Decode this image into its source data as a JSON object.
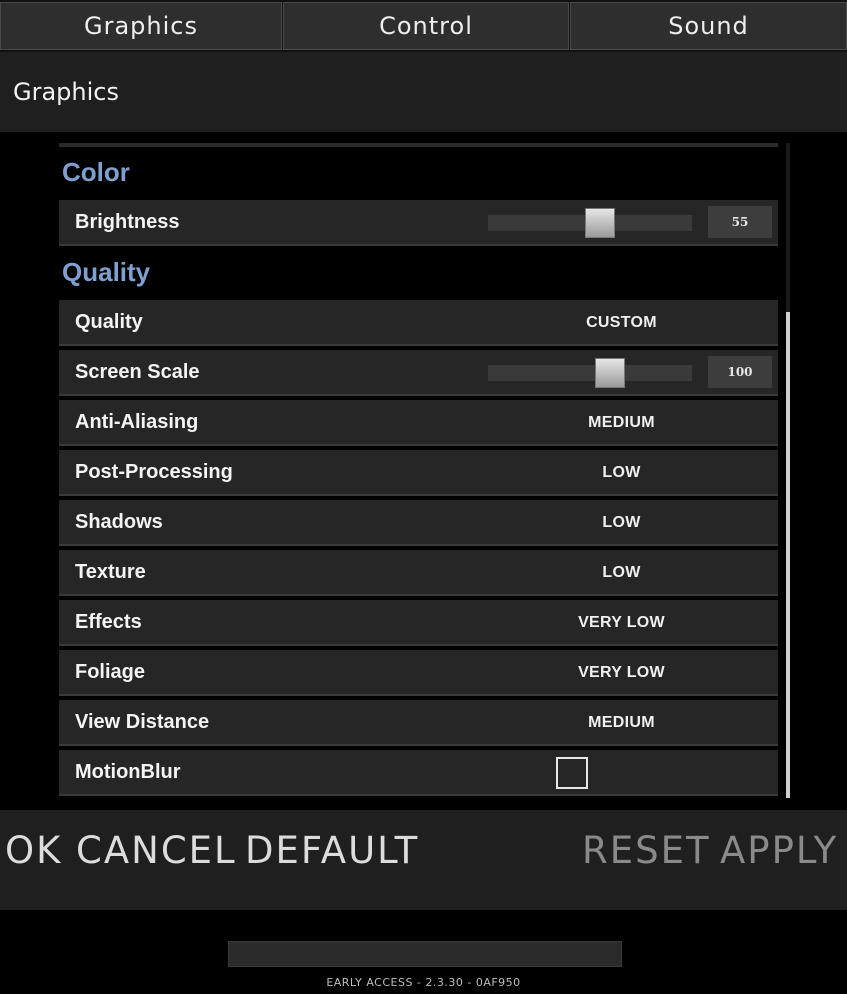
{
  "tabs": [
    "Graphics",
    "Control",
    "Sound"
  ],
  "section_title": "Graphics",
  "groups": {
    "color": "Color",
    "quality": "Quality"
  },
  "brightness": {
    "label": "Brightness",
    "value": "55",
    "level": 0.55
  },
  "quality": {
    "label": "Quality",
    "value": "CUSTOM"
  },
  "screen_scale": {
    "label": "Screen Scale",
    "value": "100",
    "level": 0.6
  },
  "options": [
    {
      "label": "Anti-Aliasing",
      "value": "MEDIUM"
    },
    {
      "label": "Post-Processing",
      "value": "LOW"
    },
    {
      "label": "Shadows",
      "value": "LOW"
    },
    {
      "label": "Texture",
      "value": "LOW"
    },
    {
      "label": "Effects",
      "value": "VERY LOW"
    },
    {
      "label": "Foliage",
      "value": "VERY LOW"
    },
    {
      "label": "View Distance",
      "value": "MEDIUM"
    }
  ],
  "motion_blur": {
    "label": "MotionBlur",
    "checked": false
  },
  "footer": {
    "ok": "OK",
    "cancel": "CANCEL",
    "default": "DEFAULT",
    "reset": "RESET",
    "apply": "APPLY"
  },
  "version": "EARLY ACCESS - 2.3.30 - 0AF950",
  "colors": {
    "group_heading": "#7f9fd0",
    "row_bg": "#262626",
    "panel_bg": "#1f1f1f"
  }
}
